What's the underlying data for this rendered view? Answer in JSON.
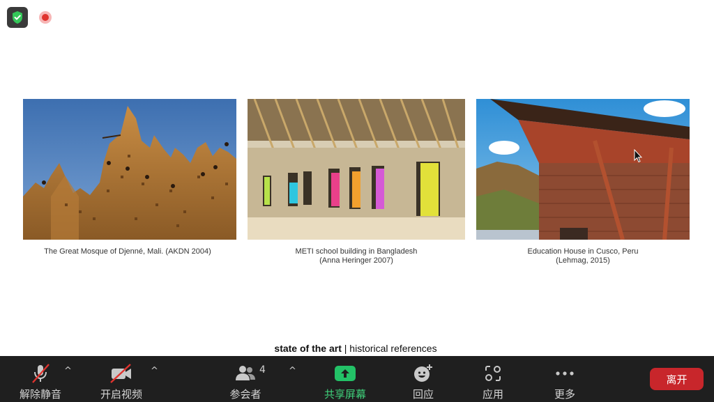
{
  "top_icons": {
    "security": "shield-check-icon",
    "recording": "recording-icon",
    "security_color": "#34c759",
    "recording_color": "#e0332e"
  },
  "slide": {
    "images": [
      {
        "caption_line1": "The Great Mosque of Djenné, Mali. (AKDN 2004)",
        "caption_line2": ""
      },
      {
        "caption_line1": "METI school building in Bangladesh",
        "caption_line2": "(Anna Heringer 2007)"
      },
      {
        "caption_line1": "Education House in Cusco, Peru",
        "caption_line2": "(Lehmag, 2015)"
      }
    ],
    "title_bold": "state of the art",
    "title_separator": " | ",
    "title_rest": "historical references"
  },
  "toolbar": {
    "unmute_label": "解除静音",
    "video_label": "开启视频",
    "participants_label": "参会者",
    "participants_count": "4",
    "share_label": "共享屏幕",
    "reactions_label": "回应",
    "apps_label": "应用",
    "more_label": "更多",
    "leave_label": "离开",
    "share_color": "#23c267",
    "leave_color": "#c8262b"
  }
}
